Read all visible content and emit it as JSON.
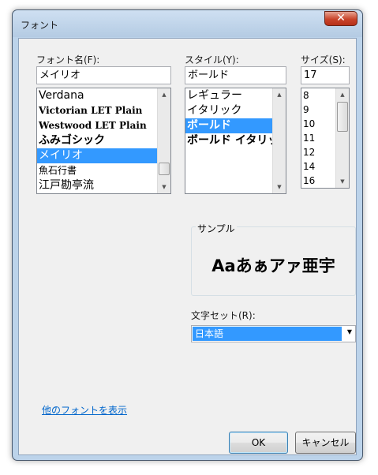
{
  "window": {
    "title": "フォント",
    "close_label": "✕"
  },
  "font": {
    "label": "フォント名(F):",
    "value": "メイリオ",
    "items": [
      "Verdana",
      "Victorian LET Plain",
      "Westwood LET Plain",
      "ふみゴシック",
      "メイリオ",
      "魚石行書",
      "江戸勘亭流"
    ],
    "selected_index": 4
  },
  "style": {
    "label": "スタイル(Y):",
    "value": "ボールド",
    "items": [
      "レギュラー",
      "イタリック",
      "ボールド",
      "ボールド イタリック"
    ],
    "selected_index": 2
  },
  "size": {
    "label": "サイズ(S):",
    "value": "17",
    "items": [
      "8",
      "9",
      "10",
      "11",
      "12",
      "14",
      "16"
    ]
  },
  "sample": {
    "title": "サンプル",
    "text": "Aaあぁアァ亜宇"
  },
  "charset": {
    "label": "文字セット(R):",
    "value": "日本語"
  },
  "show_more_fonts_link": "他のフォントを表示",
  "buttons": {
    "ok": "OK",
    "cancel": "キャンセル"
  },
  "icons": {
    "scroll_up": "triangle-up-icon",
    "scroll_down": "triangle-down-icon",
    "dropdown": "triangle-down-icon"
  },
  "colors": {
    "selection": "#3399ff",
    "link": "#0066cc"
  }
}
